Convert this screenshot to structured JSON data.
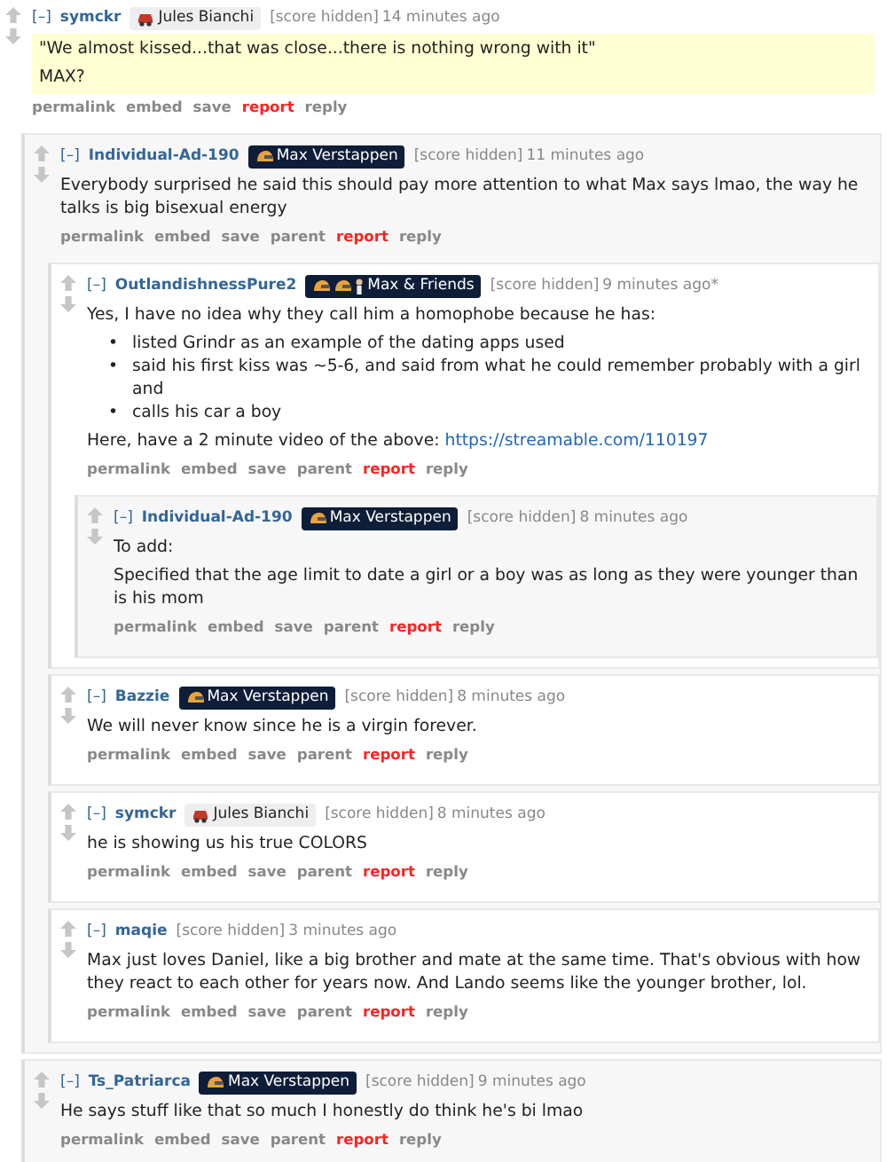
{
  "comments": [
    {
      "author": "symckr",
      "flair": {
        "kind": "car",
        "text": "Jules Bianchi"
      },
      "score": "[score hidden]",
      "time": "14 minutes ago",
      "highlighted": true,
      "body": [
        {
          "kind": "p",
          "text": "\"We almost kissed...that was close...there is nothing wrong with it\""
        },
        {
          "kind": "p",
          "text": "MAX?"
        }
      ],
      "actions": [
        {
          "label": "permalink",
          "kind": "plain"
        },
        {
          "label": "embed",
          "kind": "plain"
        },
        {
          "label": "save",
          "kind": "plain"
        },
        {
          "label": "report",
          "kind": "report"
        },
        {
          "label": "reply",
          "kind": "plain"
        }
      ],
      "children": [
        {
          "author": "Individual-Ad-190",
          "flair": {
            "kind": "helmet",
            "text": "Max Verstappen"
          },
          "score": "[score hidden]",
          "time": "11 minutes ago",
          "highlighted": false,
          "body": [
            {
              "kind": "p",
              "text": "Everybody surprised he said this should pay more attention to what Max says lmao, the way he talks is big bisexual energy"
            }
          ],
          "actions": [
            {
              "label": "permalink",
              "kind": "plain"
            },
            {
              "label": "embed",
              "kind": "plain"
            },
            {
              "label": "save",
              "kind": "plain"
            },
            {
              "label": "parent",
              "kind": "plain"
            },
            {
              "label": "report",
              "kind": "report"
            },
            {
              "label": "reply",
              "kind": "plain"
            }
          ],
          "children": [
            {
              "author": "OutlandishnessPure2",
              "flair": {
                "kind": "group",
                "text": "Max & Friends"
              },
              "score": "[score hidden]",
              "time": "9 minutes ago*",
              "highlighted": false,
              "body": [
                {
                  "kind": "p",
                  "text": "Yes, I have no idea why they call him a homophobe because he has:"
                },
                {
                  "kind": "list",
                  "items": [
                    {
                      "marker": "•",
                      "text": "listed Grindr as an example of the dating apps used"
                    },
                    {
                      "marker": "•",
                      "text": "said his first kiss was ~5-6, and said from what he could remember probably with a girl and"
                    },
                    {
                      "marker": "•",
                      "text": "calls his car a boy"
                    }
                  ]
                },
                {
                  "kind": "p",
                  "text": "Here, have a 2 minute video of the above:",
                  "link": "https://streamable.com/110197"
                }
              ],
              "actions": [
                {
                  "label": "permalink",
                  "kind": "plain"
                },
                {
                  "label": "embed",
                  "kind": "plain"
                },
                {
                  "label": "save",
                  "kind": "plain"
                },
                {
                  "label": "parent",
                  "kind": "plain"
                },
                {
                  "label": "report",
                  "kind": "report"
                },
                {
                  "label": "reply",
                  "kind": "plain"
                }
              ],
              "children": [
                {
                  "author": "Individual-Ad-190",
                  "flair": {
                    "kind": "helmet",
                    "text": "Max Verstappen"
                  },
                  "score": "[score hidden]",
                  "time": "8 minutes ago",
                  "highlighted": false,
                  "body": [
                    {
                      "kind": "p",
                      "text": "To add:"
                    },
                    {
                      "kind": "p",
                      "text": "Specified that the age limit to date a girl or a boy was as long as they were younger than is his mom"
                    }
                  ],
                  "actions": [
                    {
                      "label": "permalink",
                      "kind": "plain"
                    },
                    {
                      "label": "embed",
                      "kind": "plain"
                    },
                    {
                      "label": "save",
                      "kind": "plain"
                    },
                    {
                      "label": "parent",
                      "kind": "plain"
                    },
                    {
                      "label": "report",
                      "kind": "report"
                    },
                    {
                      "label": "reply",
                      "kind": "plain"
                    }
                  ]
                }
              ]
            },
            {
              "author": "Bazzie",
              "flair": {
                "kind": "helmet",
                "text": "Max Verstappen"
              },
              "score": "[score hidden]",
              "time": "8 minutes ago",
              "highlighted": false,
              "body": [
                {
                  "kind": "p",
                  "text": "We will never know since he is a virgin forever."
                }
              ],
              "actions": [
                {
                  "label": "permalink",
                  "kind": "plain"
                },
                {
                  "label": "embed",
                  "kind": "plain"
                },
                {
                  "label": "save",
                  "kind": "plain"
                },
                {
                  "label": "parent",
                  "kind": "plain"
                },
                {
                  "label": "report",
                  "kind": "report"
                },
                {
                  "label": "reply",
                  "kind": "plain"
                }
              ]
            },
            {
              "author": "symckr",
              "flair": {
                "kind": "car",
                "text": "Jules Bianchi"
              },
              "score": "[score hidden]",
              "time": "8 minutes ago",
              "highlighted": false,
              "body": [
                {
                  "kind": "p",
                  "text": "he is showing us his true COLORS"
                }
              ],
              "actions": [
                {
                  "label": "permalink",
                  "kind": "plain"
                },
                {
                  "label": "embed",
                  "kind": "plain"
                },
                {
                  "label": "save",
                  "kind": "plain"
                },
                {
                  "label": "parent",
                  "kind": "plain"
                },
                {
                  "label": "report",
                  "kind": "report"
                },
                {
                  "label": "reply",
                  "kind": "plain"
                }
              ]
            },
            {
              "author": "maqie",
              "score": "[score hidden]",
              "time": "3 minutes ago",
              "highlighted": false,
              "body": [
                {
                  "kind": "p",
                  "text": "Max just loves Daniel, like a big brother and mate at the same time. That's obvious with how they react to each other for years now. And Lando seems like the younger brother, lol."
                }
              ],
              "actions": [
                {
                  "label": "permalink",
                  "kind": "plain"
                },
                {
                  "label": "embed",
                  "kind": "plain"
                },
                {
                  "label": "save",
                  "kind": "plain"
                },
                {
                  "label": "parent",
                  "kind": "plain"
                },
                {
                  "label": "report",
                  "kind": "report"
                },
                {
                  "label": "reply",
                  "kind": "plain"
                }
              ]
            }
          ]
        },
        {
          "author": "Ts_Patriarca",
          "flair": {
            "kind": "helmet",
            "text": "Max Verstappen"
          },
          "score": "[score hidden]",
          "time": "9 minutes ago",
          "highlighted": false,
          "body": [
            {
              "kind": "p",
              "text": "He says stuff like that so much I honestly do think he's bi lmao"
            }
          ],
          "actions": [
            {
              "label": "permalink",
              "kind": "plain"
            },
            {
              "label": "embed",
              "kind": "plain"
            },
            {
              "label": "save",
              "kind": "plain"
            },
            {
              "label": "parent",
              "kind": "plain"
            },
            {
              "label": "report",
              "kind": "report"
            },
            {
              "label": "reply",
              "kind": "plain"
            }
          ]
        }
      ]
    }
  ],
  "collapse_label": "[–]"
}
